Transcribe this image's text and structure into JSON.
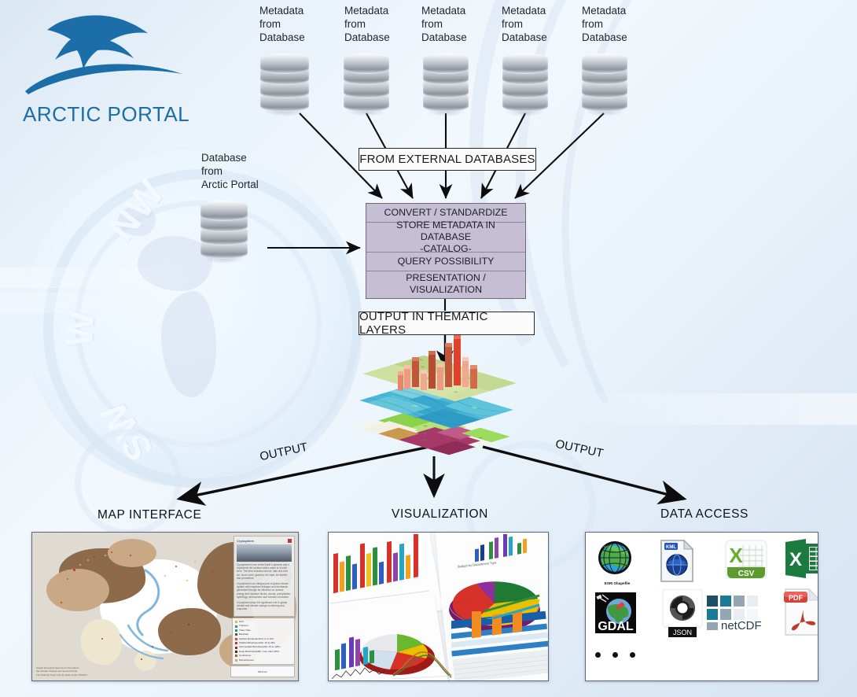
{
  "brand": {
    "name": "ARCTIC PORTAL",
    "logo_icon": "arctic-tern-bird-icon",
    "color": "#1b6ea8"
  },
  "sources": {
    "external_label": "FROM EXTERNAL DATABASES",
    "databases": [
      {
        "label": "Metadata\nfrom\nDatabase",
        "line1": "Metadata",
        "line2": "from",
        "line3": "Database"
      },
      {
        "label": "Metadata\nfrom\nDatabase",
        "line1": "Metadata",
        "line2": "from",
        "line3": "Database"
      },
      {
        "label": "Metadata\nfrom\nDatabase",
        "line1": "Metadata",
        "line2": "from",
        "line3": "Database"
      },
      {
        "label": "Metadata\nfrom\nDatabase",
        "line1": "Metadata",
        "line2": "from",
        "line3": "Database"
      },
      {
        "label": "Metadata\nfrom\nDatabase",
        "line1": "Metadata",
        "line2": "from",
        "line3": "Database"
      }
    ],
    "internal": {
      "line1": "Database",
      "line2": "from",
      "line3": "Arctic Portal"
    }
  },
  "process": {
    "steps": [
      "CONVERT / STANDARDIZE",
      "STORE METADATA IN DATABASE\n-CATALOG-",
      "QUERY POSSIBILITY",
      "PRESENTATION / VISUALIZATION"
    ],
    "step1": "CONVERT / STANDARDIZE",
    "step2_line1": "STORE METADATA IN DATABASE",
    "step2_line2": "-CATALOG-",
    "step3": "QUERY POSSIBILITY",
    "step4": "PRESENTATION / VISUALIZATION",
    "box_color": "#c6bed4"
  },
  "output_box": "OUTPUT IN THEMATIC LAYERS",
  "layers": {
    "count": 3,
    "top_layer": "3d-bar-terrain-layer",
    "middle_layer": "bathymetry-raster-layer",
    "bottom_layer": "landcover-raster-layer"
  },
  "arrow_labels": {
    "left": "OUTPUT",
    "right": "OUTPUT"
  },
  "outputs": [
    {
      "title": "MAP INTERFACE"
    },
    {
      "title": "VISUALIZATION"
    },
    {
      "title": "DATA ACCESS"
    }
  ],
  "map_panel": {
    "title": "MAP INTERFACE",
    "info": {
      "heading": "Cryosphere",
      "paragraph1": "Cryosphere is one of the Earth´s spheres and it represents the surface where water is in solid form. The term includes sea ice, lake and river ice, snow cover, glaciers, ice caps, ice sheets and permafrost.",
      "paragraph2": "Cryosphere is an integral part of global climate system with important linkages and feedbacks generated through its influence on surface energy and moisture fluxes, clouds, precipitation, hydrology, atmospheric and oceanic circulation.",
      "paragraph3": "Cryosphere plays the significant role in global climate and climate change monitoring and response.",
      "close_icon": "close-icon"
    },
    "legend": [
      {
        "label": "Grid",
        "color": "#e8b93a"
      },
      {
        "label": "Transect",
        "color": "#3b7fd4"
      },
      {
        "label": "Thaw Tube",
        "color": "#2a9a5b"
      },
      {
        "label": "Borehole",
        "color": "#555555"
      },
      {
        "label": "Surface Boreholes(SU): 0 to 10m",
        "color": "#e0452d"
      },
      {
        "label": "Shallow Boreholes(SH): 10 to 25m",
        "color": "#c0392b"
      },
      {
        "label": "Intermediate Boreholes(ID): 25 to 125m",
        "color": "#8e2b20"
      },
      {
        "label": "Deep Boreholes(DB): more than 125m",
        "color": "#5e1f18"
      },
      {
        "label": "Continuous",
        "color": "#8d6a4a"
      },
      {
        "label": "Discontinuous",
        "color": "#c9a885"
      }
    ],
    "scale": "940.8 km",
    "credit_line1": "Global Terrestrial Network for Permafrost",
    "credit_line2": "the Climate Change and Sea Ice Portal",
    "credit_line3": "The National Snow and Ice Data Center (NSIDC)"
  },
  "viz_panel": {
    "title": "VISUALIZATION",
    "content": "photo-of-printed-bar-pie-and-line-charts",
    "chart_title": "Budget by Department Type"
  },
  "data_access_panel": {
    "title": "DATA ACCESS",
    "formats": [
      {
        "name": "ESRI Shapefile",
        "icon": "esri-shapefile-globe-icon",
        "caption": "ESRI Shapefile"
      },
      {
        "name": "KML",
        "icon": "kml-document-icon",
        "caption": "KML"
      },
      {
        "name": "CSV",
        "icon": "csv-spreadsheet-icon",
        "caption": "CSV"
      },
      {
        "name": "Excel",
        "icon": "excel-xlsx-icon",
        "caption": "X"
      },
      {
        "name": "GDAL",
        "icon": "gdal-icon",
        "caption": "GDAL"
      },
      {
        "name": "JSON",
        "icon": "json-icon",
        "caption": "JSON"
      },
      {
        "name": "netCDF",
        "icon": "netcdf-icon",
        "caption": "netCDF"
      },
      {
        "name": "PDF",
        "icon": "pdf-document-icon",
        "caption": "PDF"
      }
    ],
    "more_indicator": "three-dots-more-icon"
  },
  "background": {
    "compass_labels": [
      "NW",
      "W",
      "SW"
    ],
    "motif": "compass-rose-with-globe"
  }
}
